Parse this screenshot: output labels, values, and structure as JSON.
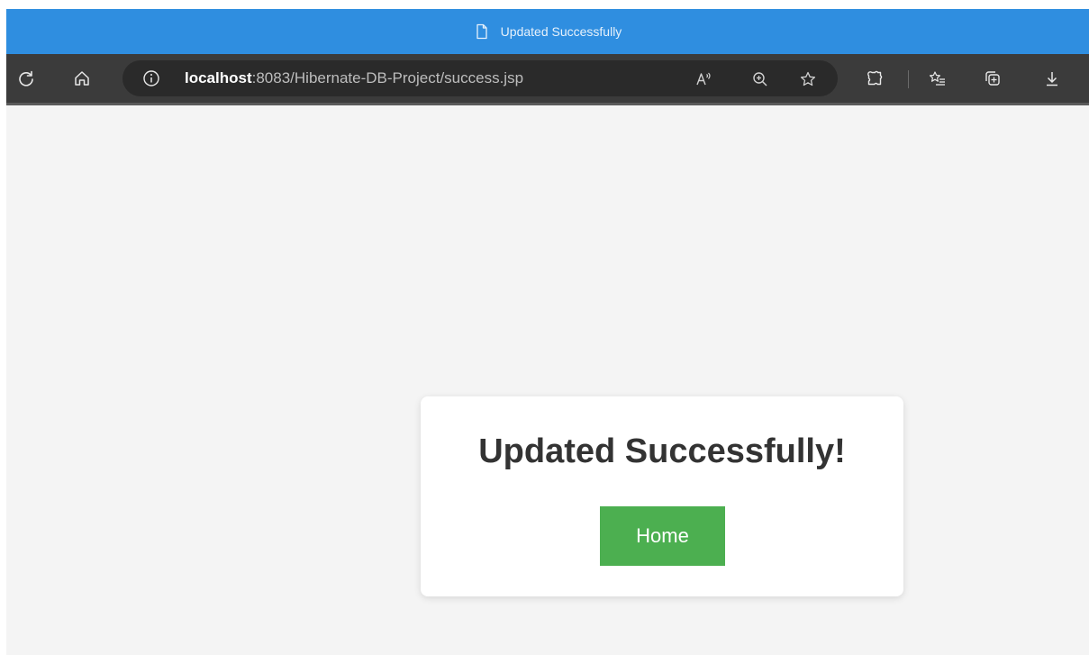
{
  "window": {
    "title": "Updated Successfully",
    "title_icon": "document-icon",
    "titlebar_color": "#2f8ee0"
  },
  "toolbar": {
    "left_icons": [
      "refresh-icon",
      "home-icon"
    ],
    "address": {
      "info_icon": "info-icon",
      "host": "localhost",
      "path": ":8083/Hibernate-DB-Project/success.jsp",
      "actions": [
        "read-aloud-icon",
        "zoom-icon",
        "favorite-star-icon"
      ]
    },
    "right_icons": [
      "extensions-icon",
      "favorites-icon",
      "collections-icon",
      "download-icon"
    ]
  },
  "page": {
    "heading": "Updated Successfully!",
    "home_button_label": "Home",
    "accent_color": "#4caf50",
    "background": "#f4f4f4"
  }
}
